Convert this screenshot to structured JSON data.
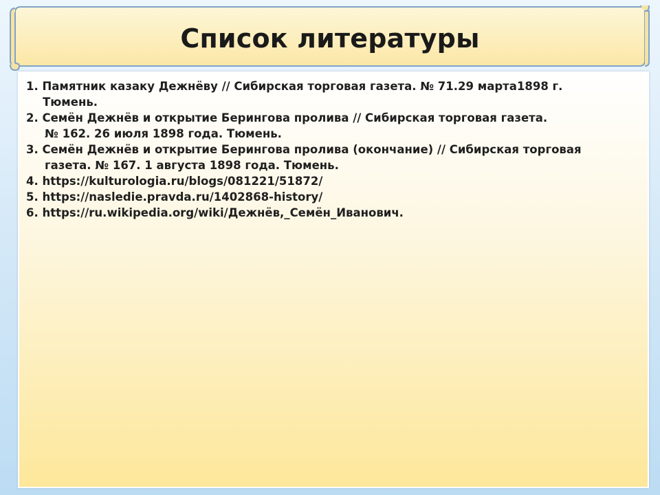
{
  "title": "Список литературы",
  "colors": {
    "banner_fill": "#fdf3c8",
    "banner_border": "#7a9fc2",
    "panel_top": "#ffffff",
    "panel_bottom": "#fde79a",
    "background": "#d6e9f8",
    "text": "#1f1f1f"
  },
  "references": [
    {
      "line1": "1. Памятник казаку Дежнёву // Сибирская торговая газета. № 71.29 марта1898 г.",
      "line2": "Тюмень."
    },
    {
      "line1": "2. Семён Дежнёв и открытие Берингова пролива // Сибирская торговая газета.",
      "line2": "№  162. 26 июля 1898 года. Тюмень."
    },
    {
      "line1": "3. Семён Дежнёв и открытие Берингова пролива (окончание) // Сибирская торговая",
      "line2": "газета. № 167. 1 августа 1898 года. Тюмень."
    },
    {
      "line1": "4. https://kulturologia.ru/blogs/081221/51872/"
    },
    {
      "line1": "5. https://nasledie.pravda.ru/1402868-history/"
    },
    {
      "line1": "6. https://ru.wikipedia.org/wiki/Дежнёв,_Семён_Иванович."
    }
  ]
}
